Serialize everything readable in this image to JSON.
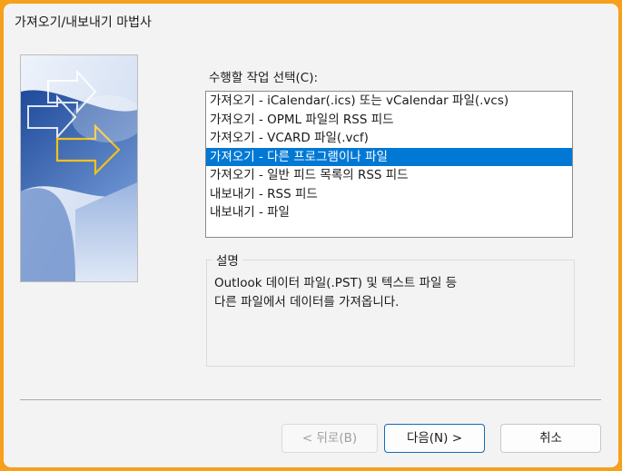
{
  "window": {
    "title": "가져오기/내보내기 마법사"
  },
  "task_select": {
    "label": "수행할 작업 선택(C):",
    "items": [
      {
        "label": "가져오기 - iCalendar(.ics) 또는 vCalendar 파일(.vcs)",
        "selected": false
      },
      {
        "label": "가져오기 - OPML 파일의 RSS 피드",
        "selected": false
      },
      {
        "label": "가져오기 - VCARD 파일(.vcf)",
        "selected": false
      },
      {
        "label": "가져오기 - 다른 프로그램이나 파일",
        "selected": true
      },
      {
        "label": "가져오기 - 일반 피드 목록의 RSS 피드",
        "selected": false
      },
      {
        "label": "내보내기 - RSS 피드",
        "selected": false
      },
      {
        "label": "내보내기 - 파일",
        "selected": false
      }
    ]
  },
  "description": {
    "label": "설명",
    "lines": [
      "Outlook 데이터 파일(.PST) 및 텍스트 파일 등",
      "다른 파일에서 데이터를 가져옵니다."
    ]
  },
  "buttons": {
    "back": "< 뒤로(B)",
    "next": "다음(N) >",
    "cancel": "취소"
  },
  "colors": {
    "selection": "#0078d4",
    "window_frame": "#f7a01c",
    "banner_blue": "#2f5fae",
    "banner_arrow": "#f2c21b"
  }
}
